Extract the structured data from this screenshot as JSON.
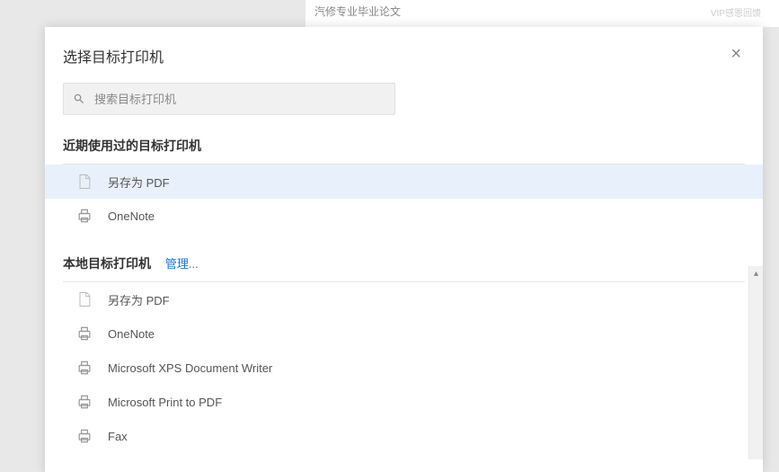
{
  "background": {
    "doc_title": "汽修专业毕业论文",
    "vip_text": "VIP感恩回馈"
  },
  "dialog": {
    "title": "选择目标打印机",
    "search_placeholder": "搜索目标打印机",
    "close_label": "×",
    "recent": {
      "heading": "近期使用过的目标打印机",
      "items": [
        {
          "label": "另存为 PDF",
          "icon": "pdf",
          "selected": true
        },
        {
          "label": "OneNote",
          "icon": "printer",
          "selected": false
        }
      ]
    },
    "local": {
      "heading": "本地目标打印机",
      "manage_label": "管理...",
      "items": [
        {
          "label": "另存为 PDF",
          "icon": "pdf"
        },
        {
          "label": "OneNote",
          "icon": "printer"
        },
        {
          "label": "Microsoft XPS Document Writer",
          "icon": "printer"
        },
        {
          "label": "Microsoft Print to PDF",
          "icon": "printer"
        },
        {
          "label": "Fax",
          "icon": "printer"
        }
      ]
    }
  }
}
